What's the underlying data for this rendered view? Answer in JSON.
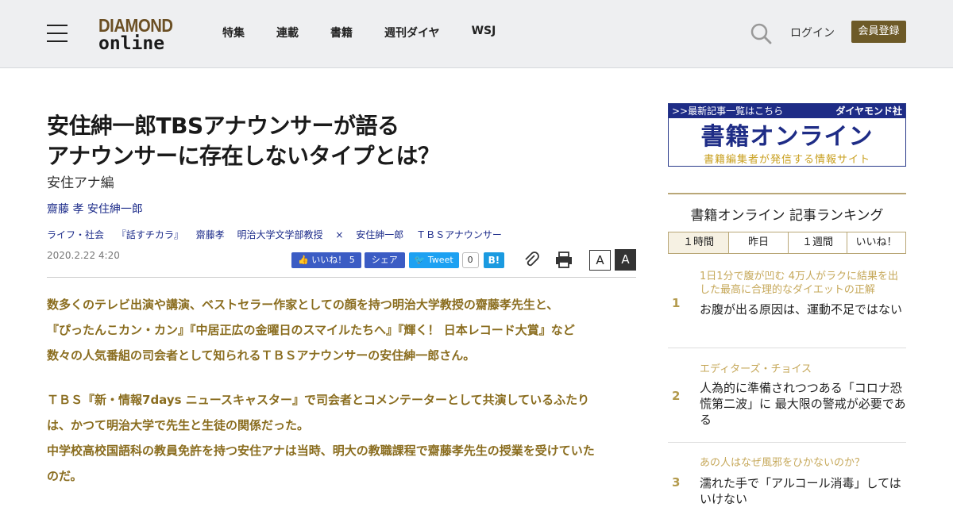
{
  "header": {
    "logo_line1": "DIAMOND",
    "logo_line2": "online",
    "nav": [
      "特集",
      "連載",
      "書籍",
      "週刊ダイヤ",
      "WSJ"
    ],
    "login": "ログイン",
    "register": "会員登録"
  },
  "article": {
    "title_line1": "安住紳一郎TBSアナウンサーが語る",
    "title_line2": "アナウンサーに存在しないタイプとは？",
    "subtitle": "安住アナ編",
    "authors": "齋藤 孝 安住紳一郎",
    "tags": [
      "ライフ・社会",
      "『話すチカラ』",
      "齋藤孝",
      "明治大学文学部教授",
      "×",
      "安住紳一郎",
      "ＴＢＳアナウンサー"
    ],
    "date": "2020.2.22 4:20",
    "social": {
      "like": "いいね！ 5",
      "share": "シェア",
      "tweet": "Tweet",
      "tweet_count": "0",
      "hatena": "B!"
    },
    "font_small": "A",
    "font_large": "A",
    "lead1": [
      "数多くのテレビ出演や講演、ベストセラー作家としての顔を持つ明治大学教授の齋藤孝先生と、",
      "『ぴったんこカン・カン』『中居正広の金曜日のスマイルたちへ』『輝く！ 日本レコード大賞』など",
      "数々の人気番組の司会者として知られるＴＢＳアナウンサーの安住紳一郎さん。"
    ],
    "lead2": [
      "ＴＢＳ『新・情報7days ニュースキャスター』で司会者とコメンテーターとして共演しているふたり",
      "は、かつて明治大学で先生と生徒の関係だった。",
      "中学校高校国語科の教員免許を持つ安住アナは当時、明大の教職課程で齋藤孝先生の授業を受けていた",
      "のだ。"
    ]
  },
  "sidebar": {
    "banner": {
      "top_left": ">>最新記事一覧はこちら",
      "top_right": "ダイヤモンド社",
      "big": "書籍オンライン",
      "sub": "書籍編集者が発信する情報サイト"
    },
    "ranking_title": "書籍オンライン 記事ランキング",
    "tabs": [
      "１時間",
      "昨日",
      "１週間",
      "いいね！"
    ],
    "items": [
      {
        "rank": "1",
        "category": "1日1分で腹が凹む 4万人がラクに結果を出した最高に合理的なダイエットの正解",
        "headline": "お腹が出る原因は、運動不足ではない"
      },
      {
        "rank": "2",
        "category": "エディターズ・チョイス",
        "headline": "人為的に準備されつつある「コロナ恐慌第二波」に 最大限の警戒が必要である"
      },
      {
        "rank": "3",
        "category": "あの人はなぜ風邪をひかないのか？",
        "headline": "濡れた手で「アルコール消毒」してはいけない"
      }
    ]
  }
}
